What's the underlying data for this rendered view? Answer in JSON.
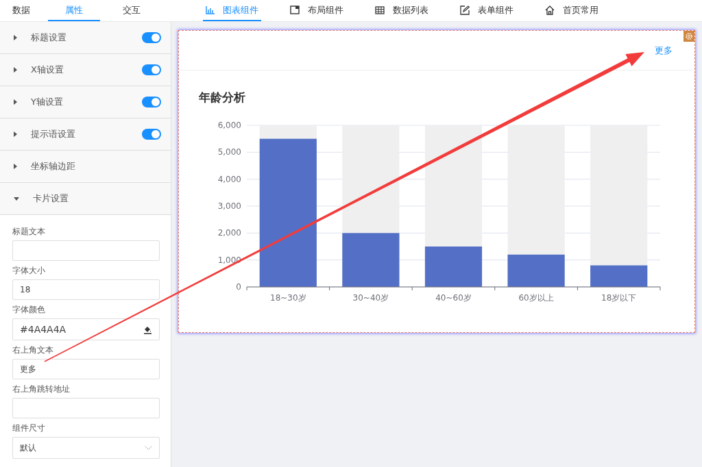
{
  "panel_tabs": [
    {
      "label": "数据",
      "selected": false
    },
    {
      "label": "属性",
      "selected": true
    },
    {
      "label": "交互",
      "selected": false
    }
  ],
  "component_tabs": [
    {
      "label": "图表组件",
      "selected": true
    },
    {
      "label": "布局组件",
      "selected": false
    },
    {
      "label": "数据列表",
      "selected": false
    },
    {
      "label": "表单组件",
      "selected": false
    },
    {
      "label": "首页常用",
      "selected": false
    }
  ],
  "sections": [
    {
      "title": "标题设置",
      "kind": "toggle",
      "on": true,
      "expanded": false
    },
    {
      "title": "X轴设置",
      "kind": "toggle",
      "on": true,
      "expanded": false
    },
    {
      "title": "Y轴设置",
      "kind": "toggle",
      "on": true,
      "expanded": false
    },
    {
      "title": "提示语设置",
      "kind": "toggle",
      "on": true,
      "expanded": false
    },
    {
      "title": "坐标轴边距",
      "kind": "plain",
      "expanded": false
    },
    {
      "title": "卡片设置",
      "kind": "plain",
      "expanded": true
    }
  ],
  "card_fields": [
    {
      "label": "标题文本",
      "kind": "input"
    },
    {
      "label": "字体大小",
      "kind": "input",
      "value": "18"
    },
    {
      "label": "字体颜色",
      "kind": "color",
      "value": "#4A4A4A"
    },
    {
      "label": "右上角文本",
      "kind": "input",
      "value": "更多"
    },
    {
      "label": "右上角跳转地址",
      "kind": "input"
    },
    {
      "label": "组件尺寸",
      "kind": "select",
      "value": "默认"
    }
  ],
  "card": {
    "link": "更多",
    "title": "年龄分析",
    "chart_data": {
      "type": "bar",
      "grid": true,
      "categories": [
        "18~30岁",
        "30~40岁",
        "40~60岁",
        "60岁以上",
        "18岁以下"
      ],
      "values": [
        5500,
        2000,
        1500,
        1200,
        800
      ],
      "ylim": [
        0,
        6000
      ],
      "yticks": [
        {
          "value": 0,
          "label": "0"
        },
        {
          "value": 1000,
          "label": "1,000"
        },
        {
          "value": 2000,
          "label": "2,000"
        },
        {
          "value": 3000,
          "label": "3,000"
        },
        {
          "value": 4000,
          "label": "4,000"
        },
        {
          "value": 5000,
          "label": "5,000"
        },
        {
          "value": 6000,
          "label": "6,000"
        }
      ]
    }
  }
}
